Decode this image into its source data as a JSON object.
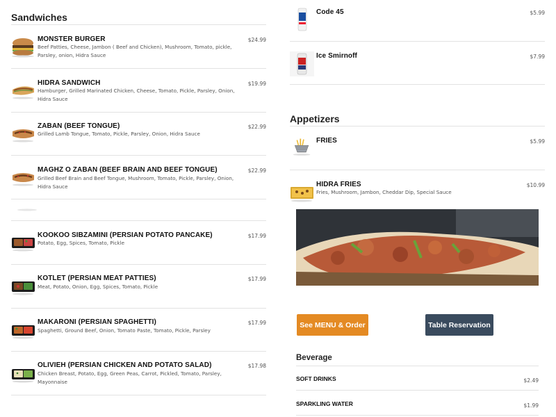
{
  "sandwiches": {
    "title": "Sandwiches",
    "items": [
      {
        "name": "MONSTER BURGER",
        "desc": "Beef Patties, Cheese, Jambon ( Beef and Chicken), Mushroom, Tomato, pickle, Parsley, onion, Hidra Sauce",
        "price": "$24.99"
      },
      {
        "name": "HIDRA SANDWICH",
        "desc": "Hamburger, Grilled Marinated Chicken, Cheese, Tomato, Pickle, Parsley, Onion, Hidra Sauce",
        "price": "$19.99"
      },
      {
        "name": "ZABAN (BEEF TONGUE)",
        "desc": "Grilled Lamb Tongue, Tomato, Pickle, Parsley, Onion, Hidra Sauce",
        "price": "$22.99"
      },
      {
        "name": "MAGHZ O ZABAN (BEEF BRAIN AND BEEF TONGUE)",
        "desc": "Grilled Beef Brain and Beef Tongue, Mushroom, Tomato, Pickle, Parsley, Onion, Hidra Sauce",
        "price": "$22.99"
      },
      {
        "name": "KOOKOO SIBZAMINI (PERSIAN POTATO PANCAKE)",
        "desc": "Potato, Egg, Spices, Tomato, Pickle",
        "price": "$17.99"
      },
      {
        "name": "KOTLET (PERSIAN MEAT PATTIES)",
        "desc": "Meat, Potato, Onion, Egg, Spices, Tomato, Pickle",
        "price": "$17.99"
      },
      {
        "name": "MAKARONI (PERSIAN SPAGHETTI)",
        "desc": "Spaghetti, Ground Beef, Onion, Tomato Paste, Tomato, Pickle, Parsley",
        "price": "$17.99"
      },
      {
        "name": "OLIVIEH (PERSIAN CHICKEN AND POTATO SALAD)",
        "desc": "Chicken Breast, Potato, Egg, Green Peas, Carrot, Pickled, Tomato, Parsley, Mayonnaise",
        "price": "$17.98"
      }
    ]
  },
  "drinks": {
    "items": [
      {
        "name": "Code 45",
        "price": "$5.99"
      },
      {
        "name": "Ice Smirnoff",
        "price": "$7.99"
      }
    ]
  },
  "appetizers": {
    "title": "Appetizers",
    "items": [
      {
        "name": "FRIES",
        "desc": "",
        "price": "$5.99"
      },
      {
        "name": "HIDRA FRIES",
        "desc": "Fries, Mushroom, Jambon, Cheddar Dip, Special Sauce",
        "price": "$10.99"
      }
    ]
  },
  "buttons": {
    "menu_order": "See MENU & Order",
    "table_reservation": "Table Reservation"
  },
  "colors": {
    "menu_order_bg": "#e48a23",
    "table_reservation_bg": "#3a4b5e"
  },
  "beverage": {
    "title": "Beverage",
    "items": [
      {
        "name": "SOFT DRINKS",
        "price": "$2.49"
      },
      {
        "name": "SPARKLING WATER",
        "price": "$1.99"
      }
    ]
  }
}
